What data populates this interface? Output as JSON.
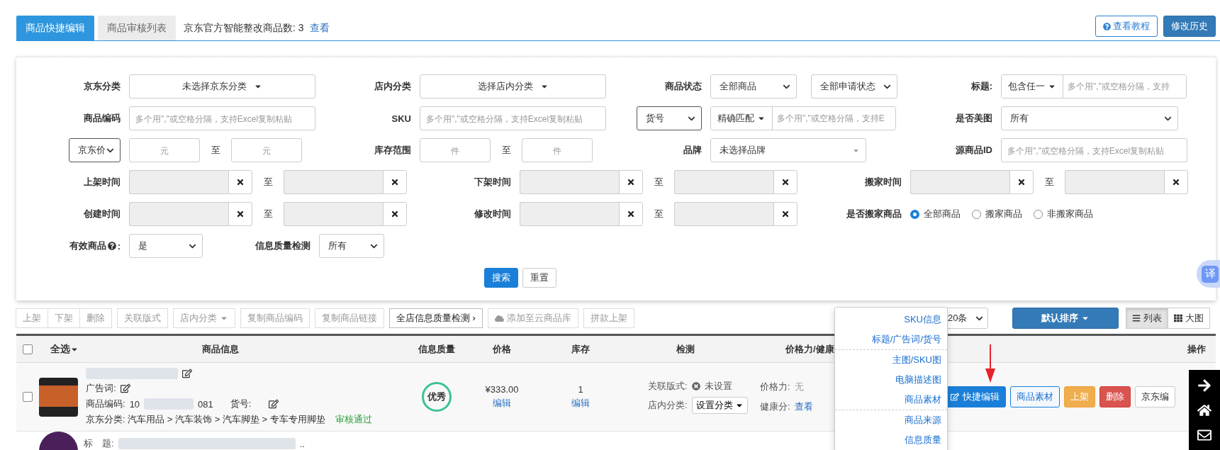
{
  "tabs": [
    {
      "label": "商品快捷编辑",
      "selected": true
    },
    {
      "label": "商品审核列表",
      "selected": false
    }
  ],
  "notice": {
    "text": "京东官方智能整改商品数: 3",
    "link": "查看"
  },
  "header_buttons": [
    {
      "label": "查看教程",
      "kind": "help"
    },
    {
      "label": "修改历史",
      "kind": "primary"
    }
  ],
  "filter_rows": [
    {
      "kind": "grid",
      "cells": [
        {
          "kind": "picker",
          "label": "京东分类",
          "value": "未选择京东分类"
        },
        {
          "kind": "picker",
          "label": "店内分类",
          "value": "选择店内分类"
        },
        {
          "kind": "selects",
          "label": "商品状态",
          "values": [
            "全部商品",
            "全部申请状态"
          ]
        },
        {
          "kind": "prefixed",
          "label": "标题:",
          "prefix": "包含任一",
          "placeholder": "多个用\",\"或空格分隔，支持"
        }
      ]
    },
    {
      "kind": "grid",
      "cells": [
        {
          "kind": "input",
          "label": "商品编码",
          "placeholder": "多个用\",\"或空格分隔，支持Excel复制粘贴"
        },
        {
          "kind": "input",
          "label": "SKU",
          "placeholder": "多个用\",\"或空格分隔，支持Excel复制粘贴"
        },
        {
          "kind": "select_prefixed",
          "select": "货号",
          "prefix": "精确匹配",
          "placeholder": "多个用\",\"或空格分隔，支持E"
        },
        {
          "kind": "select",
          "label": "是否美图",
          "value": "所有"
        }
      ]
    },
    {
      "kind": "grid",
      "cells": [
        {
          "kind": "range",
          "select": "京东价",
          "from_placeholder": "元",
          "to_label": "至",
          "to_placeholder": "元"
        },
        {
          "kind": "range",
          "label": "库存范围",
          "from_placeholder": "件",
          "to_label": "至",
          "to_placeholder": "件"
        },
        {
          "kind": "combo",
          "label": "品牌",
          "value": "未选择品牌"
        },
        {
          "kind": "input",
          "label": "源商品ID",
          "placeholder": "多个用\",\"或空格分隔，支持Excel复制粘贴"
        }
      ]
    },
    {
      "kind": "dates",
      "cells": [
        {
          "kind": "date_range",
          "label": "上架时间",
          "to_label": "至"
        },
        {
          "kind": "date_range",
          "label": "下架时间",
          "to_label": "至"
        },
        {
          "kind": "date_range",
          "label": "搬家时间",
          "to_label": "至"
        }
      ]
    },
    {
      "kind": "dates",
      "cells": [
        {
          "kind": "date_range",
          "label": "创建时间",
          "to_label": "至"
        },
        {
          "kind": "date_range",
          "label": "修改时间",
          "to_label": "至"
        },
        {
          "kind": "radios",
          "label": "是否搬家商品",
          "options": [
            {
              "label": "全部商品",
              "selected": true
            },
            {
              "label": "搬家商品",
              "selected": false
            },
            {
              "label": "非搬家商品",
              "selected": false
            }
          ]
        }
      ]
    },
    {
      "kind": "compact",
      "cells": [
        {
          "kind": "select",
          "label": "有效商品",
          "help": true,
          "suffix": ":",
          "value": "是"
        },
        {
          "kind": "select",
          "label": "信息质量检测",
          "value": "所有"
        }
      ]
    }
  ],
  "search_buttons": [
    {
      "label": "搜索",
      "kind": "primary"
    },
    {
      "label": "重置",
      "kind": "default"
    }
  ],
  "toolbar": {
    "groups": [
      [
        {
          "label": "上架",
          "kind": "plain"
        },
        {
          "label": "下架",
          "kind": "plain"
        },
        {
          "label": "删除",
          "kind": "plain"
        }
      ],
      [
        {
          "label": "关联版式",
          "kind": "plain"
        }
      ],
      [
        {
          "label": "店内分类",
          "kind": "dropdown"
        }
      ],
      [
        {
          "label": "复制商品编码",
          "kind": "plain"
        }
      ],
      [
        {
          "label": "复制商品链接",
          "kind": "plain"
        }
      ],
      [
        {
          "label": "全店信息质量检测 ›",
          "kind": "emphasis"
        }
      ],
      [
        {
          "label": "添加至云商品库",
          "kind": "cloud"
        }
      ],
      [
        {
          "label": "拼款上架",
          "kind": "plain"
        }
      ]
    ],
    "page_size": "20条",
    "sort": "默认排序",
    "views": [
      {
        "label": "列表",
        "kind": "list",
        "selected": true
      },
      {
        "label": "大图",
        "kind": "grid",
        "selected": false
      }
    ]
  },
  "table": {
    "select_all": {
      "label": "全选",
      "checked": false
    },
    "columns": [
      "商品信息",
      "信息质量",
      "价格",
      "库存",
      "检测",
      "价格力/健康",
      "操作"
    ],
    "rows": [
      {
        "checked": false,
        "ad_label": "广告词:",
        "code_label": "商品编码:",
        "code_start": "10",
        "code_end": "081",
        "sku_label": "货号:",
        "category": "京东分类: 汽车用品 > 汽车装饰 > 汽车脚垫 > 专车专用脚垫",
        "review": "审核通过",
        "quality": "优秀",
        "price": "¥333.00",
        "price_edit": "编辑",
        "stock": "1",
        "stock_edit": "编辑",
        "layout_label": "关联版式:",
        "layout_value": "未设置",
        "shop_cat_label": "店内分类:",
        "shop_cat_button": "设置分类",
        "price_power_label": "价格力:",
        "price_power": "无",
        "health_label": "健康分:",
        "health_link": "查看",
        "actions": [
          {
            "label": "快捷编辑",
            "kind": "quick"
          },
          {
            "label": "商品素材",
            "kind": "outline"
          },
          {
            "label": "上架",
            "kind": "warning"
          },
          {
            "label": "删除",
            "kind": "danger"
          },
          {
            "label": "京东编",
            "kind": "default"
          }
        ]
      }
    ],
    "next_row": {
      "title_label": "标　题:",
      "tail": ".."
    }
  },
  "menu": {
    "groups": [
      [
        "SKU信息",
        "标题/广告词/货号"
      ],
      [
        "主图/SKU图",
        "电脑描述图",
        "商品素材"
      ],
      [
        "商品来源",
        "信息质量"
      ]
    ]
  },
  "translate": "译"
}
